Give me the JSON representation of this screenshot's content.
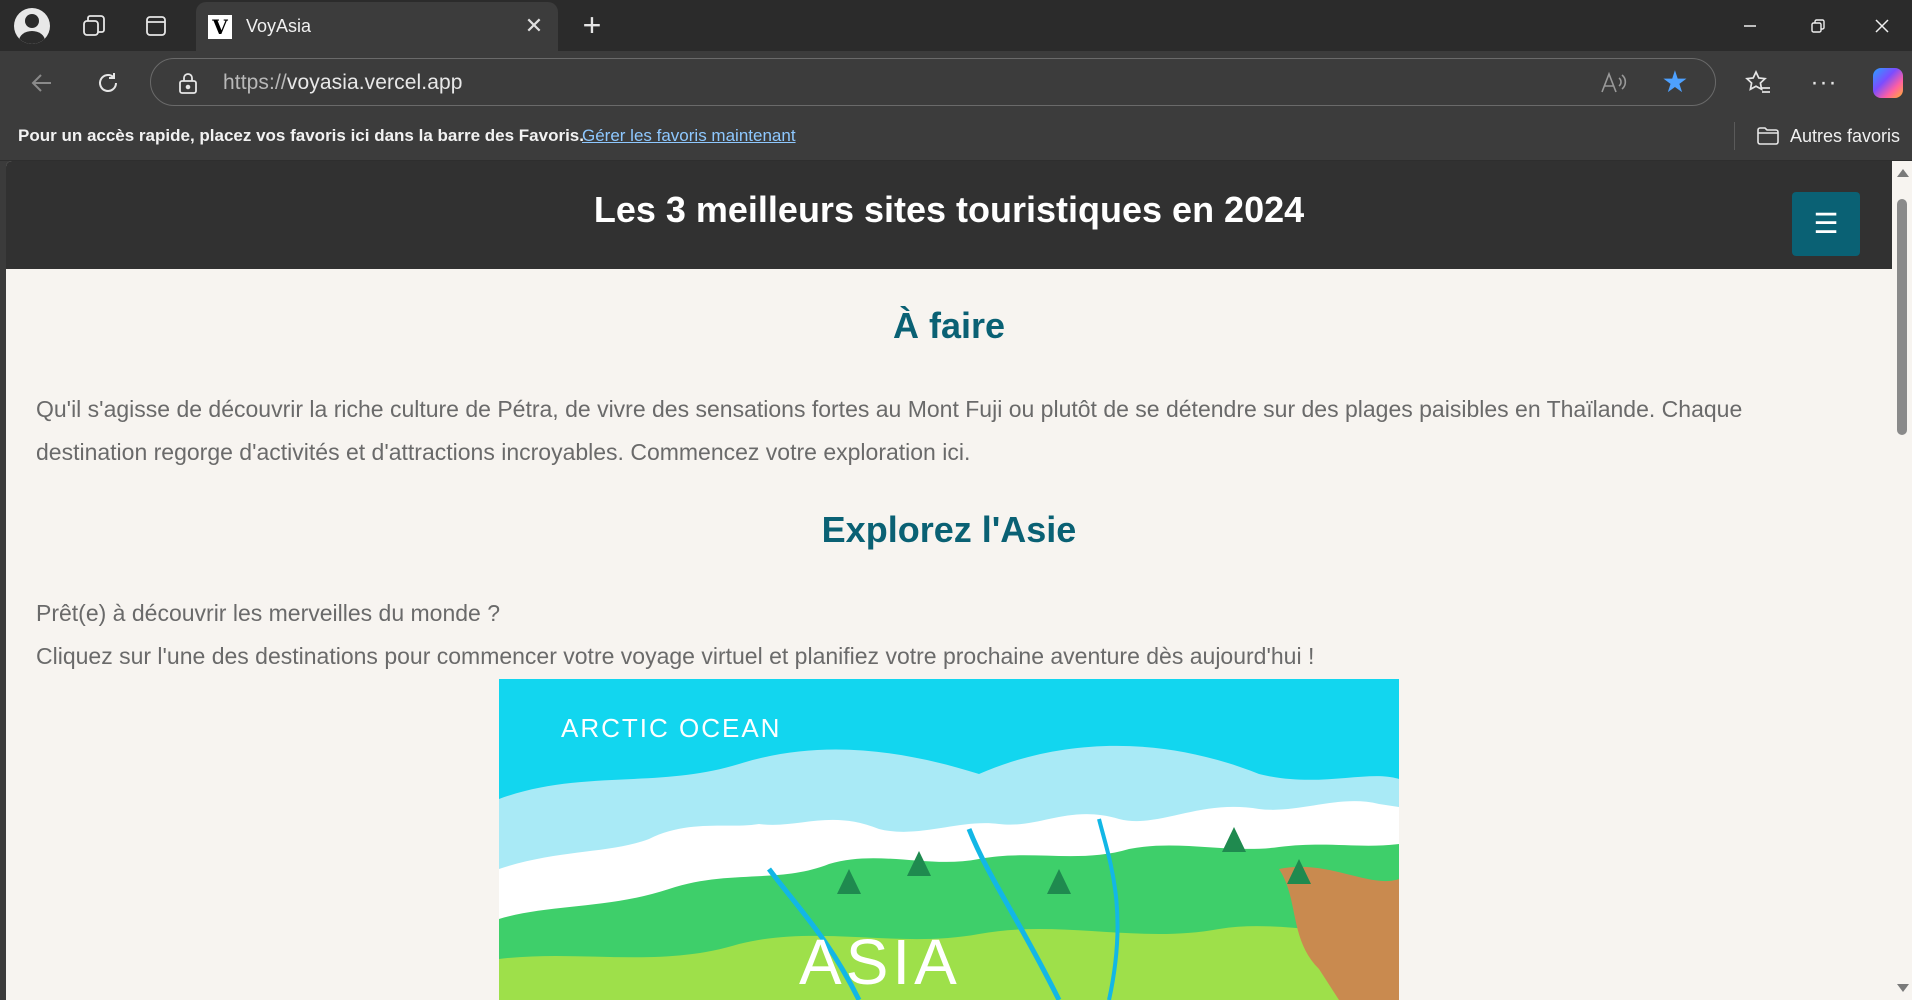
{
  "browser": {
    "tab": {
      "title": "VoyAsia",
      "favicon_letter": "V"
    },
    "address": {
      "scheme": "https://",
      "host": "voyasia.vercel.app"
    },
    "favorites_bar": {
      "prompt": "Pour un accès rapide, placez vos favoris ici dans la barre des Favoris.",
      "manage_link": "Gérer les favoris maintenant",
      "other_favorites": "Autres favoris"
    },
    "colors": {
      "accent_star": "#4ea1ff",
      "link": "#8ec8ff"
    }
  },
  "site": {
    "header_title": "Les 3 meilleurs sites touristiques en 2024",
    "menu_icon": "☰",
    "section1": {
      "title": "À faire",
      "text": "Qu'il s'agisse de découvrir la riche culture de Pétra, de vivre des sensations fortes au Mont Fuji ou plutôt de se détendre sur des plages paisibles en Thaïlande. Chaque destination regorge d'activités et d'attractions incroyables. Commencez votre exploration ici."
    },
    "section2": {
      "title": "Explorez l'Asie",
      "line1": "Prêt(e) à découvrir les merveilles du monde ?",
      "line2": "Cliquez sur l'une des destinations pour commencer votre voyage virtuel et planifiez votre prochaine aventure dès aujourd'hui !"
    },
    "map": {
      "ocean_label": "ARCTIC OCEAN",
      "continent_label": "ASIA"
    },
    "colors": {
      "primary": "#0a6174",
      "header_bg": "#313131",
      "page_bg": "#f7f4f0"
    }
  }
}
